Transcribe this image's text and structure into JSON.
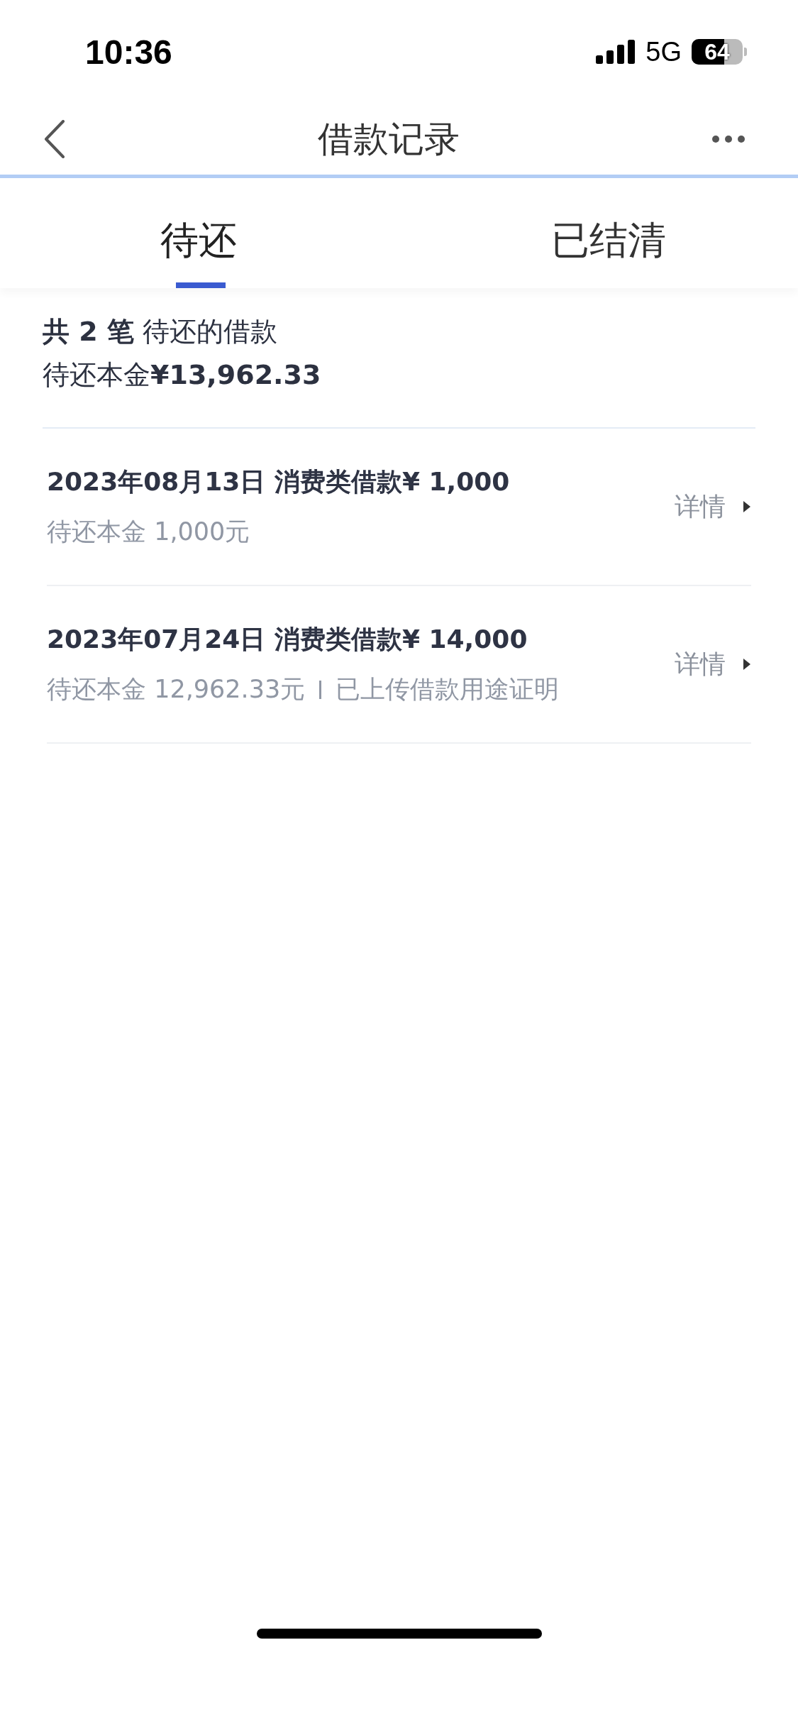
{
  "status_bar": {
    "time": "10:36",
    "network": "5G",
    "battery": "64"
  },
  "header": {
    "title": "借款记录"
  },
  "tabs": [
    {
      "label": "待还",
      "selected": true
    },
    {
      "label": "已结清",
      "selected": false
    }
  ],
  "summary": {
    "count_line": "**共 2 笔** 待还的借款",
    "principal_line": "待还本金**¥13,962.33**"
  },
  "loans": [
    {
      "title": "2023年08月13日 消费类借款¥ 1,000",
      "remaining": "待还本金 1,000元",
      "detail": "详情"
    },
    {
      "title": "2023年07月24日 消费类借款¥ 14,000",
      "remaining": "待还本金 12,962.33元",
      "note": "已上传借款用途证明",
      "detail": "详情"
    }
  ]
}
